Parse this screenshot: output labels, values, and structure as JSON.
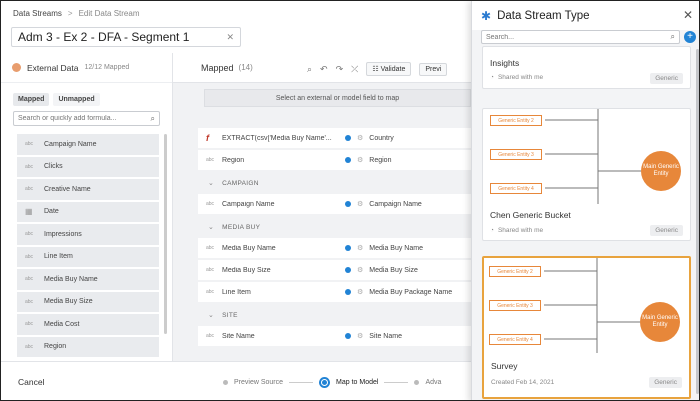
{
  "breadcrumb": {
    "root": "Data Streams",
    "separator": ">",
    "current": "Edit Data Stream"
  },
  "stream_name": {
    "value": "Adm 3 - Ex 2 - DFA - Segment 1",
    "clear_icon": "close-icon"
  },
  "left_panel": {
    "title": "External Data",
    "count": "12/12 Mapped",
    "tabs": {
      "mapped": "Mapped",
      "unmapped": "Unmapped"
    },
    "search_placeholder": "Search or quickly add formula...",
    "fields": [
      {
        "type": "abc",
        "label": "Campaign Name"
      },
      {
        "type": "abc",
        "label": "Clicks"
      },
      {
        "type": "abc",
        "label": "Creative Name"
      },
      {
        "type": "date",
        "label": "Date"
      },
      {
        "type": "abc",
        "label": "Impressions"
      },
      {
        "type": "abc",
        "label": "Line Item"
      },
      {
        "type": "abc",
        "label": "Media Buy Name"
      },
      {
        "type": "abc",
        "label": "Media Buy Size"
      },
      {
        "type": "abc",
        "label": "Media Cost"
      },
      {
        "type": "abc",
        "label": "Region"
      }
    ]
  },
  "middle_panel": {
    "title": "Mapped",
    "count": "(14)",
    "validate_label": "Validate",
    "preview_label": "Previ",
    "select_hint": "Select an external or model field to map",
    "rows": [
      {
        "kind": "formula",
        "left": "EXTRACT(csv['Media Buy Name'...",
        "right": "Country"
      },
      {
        "kind": "field",
        "left": "Region",
        "right": "Region"
      },
      {
        "kind": "section",
        "label": "CAMPAIGN"
      },
      {
        "kind": "field",
        "left": "Campaign Name",
        "right": "Campaign Name"
      },
      {
        "kind": "section",
        "label": "MEDIA BUY"
      },
      {
        "kind": "field",
        "left": "Media Buy Name",
        "right": "Media Buy Name"
      },
      {
        "kind": "field",
        "left": "Media Buy Size",
        "right": "Media Buy Size"
      },
      {
        "kind": "field",
        "left": "Line Item",
        "right": "Media Buy Package Name"
      },
      {
        "kind": "section",
        "label": "SITE"
      },
      {
        "kind": "field",
        "left": "Site Name",
        "right": "Site Name"
      }
    ]
  },
  "footer": {
    "cancel_label": "Cancel",
    "steps": [
      "Preview Source",
      "Map to Model",
      "Adva"
    ],
    "active_step": "Map to Model"
  },
  "drawer": {
    "title": "Data Stream Type",
    "search_placeholder": "Search...",
    "cards": [
      {
        "name": "Insights",
        "meta": "Shared with me",
        "badge": "Generic",
        "selected": false
      },
      {
        "name": "Chen Generic Bucket",
        "meta": "Shared with me",
        "badge": "Generic",
        "selected": false,
        "diagram": {
          "entities": [
            "Generic Entity 2",
            "Generic Entity 3",
            "Generic Entity 4"
          ],
          "main": "Main Generic Entity"
        }
      },
      {
        "name": "Survey",
        "meta": "Created Feb 14, 2021",
        "badge": "Generic",
        "selected": true,
        "diagram": {
          "entities": [
            "Generic Entity 2",
            "Generic Entity 3",
            "Generic Entity 4"
          ],
          "main": "Main Generic Entity"
        }
      }
    ]
  },
  "colors": {
    "accent": "#2183d5",
    "entity_orange": "#e7873a",
    "selected_border": "#e8a33e"
  }
}
